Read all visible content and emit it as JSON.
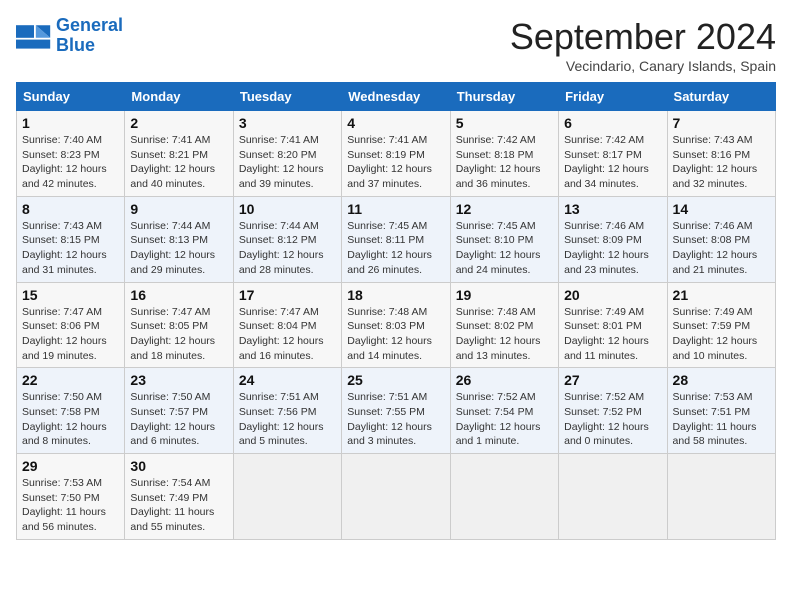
{
  "header": {
    "logo_line1": "General",
    "logo_line2": "Blue",
    "month": "September 2024",
    "location": "Vecindario, Canary Islands, Spain"
  },
  "days_of_week": [
    "Sunday",
    "Monday",
    "Tuesday",
    "Wednesday",
    "Thursday",
    "Friday",
    "Saturday"
  ],
  "weeks": [
    [
      {
        "day": "1",
        "rise": "7:40 AM",
        "set": "8:23 PM",
        "daylight": "12 hours and 42 minutes."
      },
      {
        "day": "2",
        "rise": "7:41 AM",
        "set": "8:21 PM",
        "daylight": "12 hours and 40 minutes."
      },
      {
        "day": "3",
        "rise": "7:41 AM",
        "set": "8:20 PM",
        "daylight": "12 hours and 39 minutes."
      },
      {
        "day": "4",
        "rise": "7:41 AM",
        "set": "8:19 PM",
        "daylight": "12 hours and 37 minutes."
      },
      {
        "day": "5",
        "rise": "7:42 AM",
        "set": "8:18 PM",
        "daylight": "12 hours and 36 minutes."
      },
      {
        "day": "6",
        "rise": "7:42 AM",
        "set": "8:17 PM",
        "daylight": "12 hours and 34 minutes."
      },
      {
        "day": "7",
        "rise": "7:43 AM",
        "set": "8:16 PM",
        "daylight": "12 hours and 32 minutes."
      }
    ],
    [
      {
        "day": "8",
        "rise": "7:43 AM",
        "set": "8:15 PM",
        "daylight": "12 hours and 31 minutes."
      },
      {
        "day": "9",
        "rise": "7:44 AM",
        "set": "8:13 PM",
        "daylight": "12 hours and 29 minutes."
      },
      {
        "day": "10",
        "rise": "7:44 AM",
        "set": "8:12 PM",
        "daylight": "12 hours and 28 minutes."
      },
      {
        "day": "11",
        "rise": "7:45 AM",
        "set": "8:11 PM",
        "daylight": "12 hours and 26 minutes."
      },
      {
        "day": "12",
        "rise": "7:45 AM",
        "set": "8:10 PM",
        "daylight": "12 hours and 24 minutes."
      },
      {
        "day": "13",
        "rise": "7:46 AM",
        "set": "8:09 PM",
        "daylight": "12 hours and 23 minutes."
      },
      {
        "day": "14",
        "rise": "7:46 AM",
        "set": "8:08 PM",
        "daylight": "12 hours and 21 minutes."
      }
    ],
    [
      {
        "day": "15",
        "rise": "7:47 AM",
        "set": "8:06 PM",
        "daylight": "12 hours and 19 minutes."
      },
      {
        "day": "16",
        "rise": "7:47 AM",
        "set": "8:05 PM",
        "daylight": "12 hours and 18 minutes."
      },
      {
        "day": "17",
        "rise": "7:47 AM",
        "set": "8:04 PM",
        "daylight": "12 hours and 16 minutes."
      },
      {
        "day": "18",
        "rise": "7:48 AM",
        "set": "8:03 PM",
        "daylight": "12 hours and 14 minutes."
      },
      {
        "day": "19",
        "rise": "7:48 AM",
        "set": "8:02 PM",
        "daylight": "12 hours and 13 minutes."
      },
      {
        "day": "20",
        "rise": "7:49 AM",
        "set": "8:01 PM",
        "daylight": "12 hours and 11 minutes."
      },
      {
        "day": "21",
        "rise": "7:49 AM",
        "set": "7:59 PM",
        "daylight": "12 hours and 10 minutes."
      }
    ],
    [
      {
        "day": "22",
        "rise": "7:50 AM",
        "set": "7:58 PM",
        "daylight": "12 hours and 8 minutes."
      },
      {
        "day": "23",
        "rise": "7:50 AM",
        "set": "7:57 PM",
        "daylight": "12 hours and 6 minutes."
      },
      {
        "day": "24",
        "rise": "7:51 AM",
        "set": "7:56 PM",
        "daylight": "12 hours and 5 minutes."
      },
      {
        "day": "25",
        "rise": "7:51 AM",
        "set": "7:55 PM",
        "daylight": "12 hours and 3 minutes."
      },
      {
        "day": "26",
        "rise": "7:52 AM",
        "set": "7:54 PM",
        "daylight": "12 hours and 1 minute."
      },
      {
        "day": "27",
        "rise": "7:52 AM",
        "set": "7:52 PM",
        "daylight": "12 hours and 0 minutes."
      },
      {
        "day": "28",
        "rise": "7:53 AM",
        "set": "7:51 PM",
        "daylight": "11 hours and 58 minutes."
      }
    ],
    [
      {
        "day": "29",
        "rise": "7:53 AM",
        "set": "7:50 PM",
        "daylight": "11 hours and 56 minutes."
      },
      {
        "day": "30",
        "rise": "7:54 AM",
        "set": "7:49 PM",
        "daylight": "11 hours and 55 minutes."
      },
      null,
      null,
      null,
      null,
      null
    ]
  ]
}
